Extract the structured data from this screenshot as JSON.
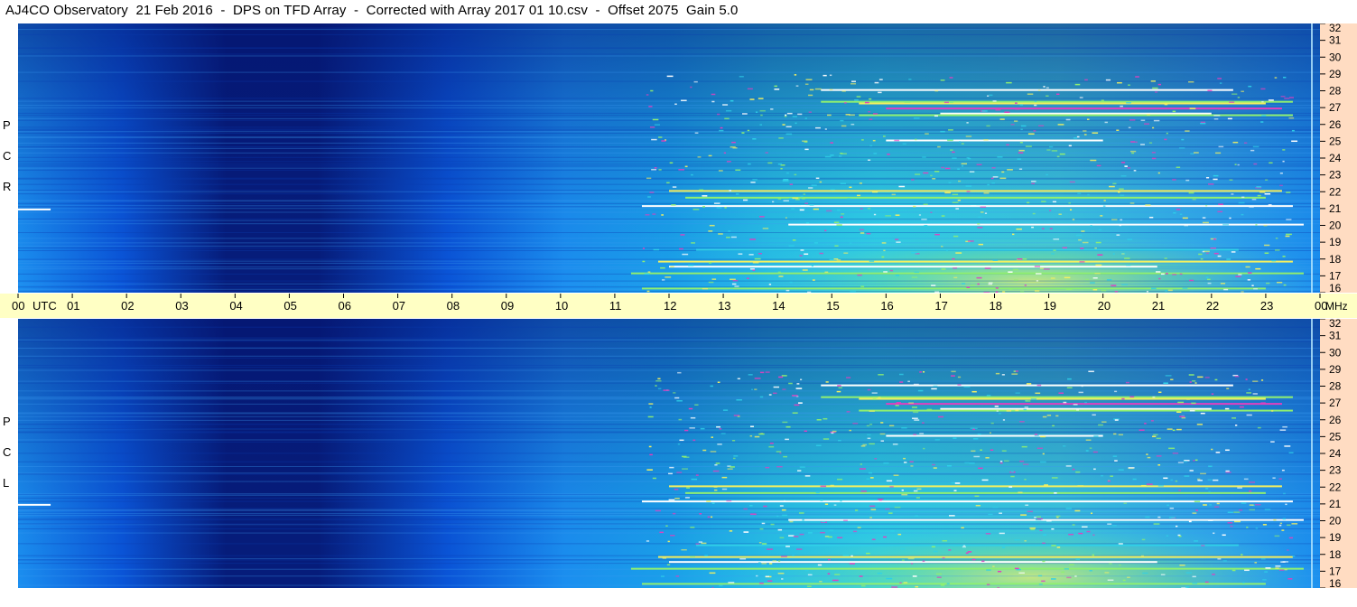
{
  "title": "AJ4CO Observatory  21 Feb 2016  -  DPS on TFD Array  -  Corrected with Array 2017 01 10.csv  -  Offset 2075  Gain 5.0",
  "chart_data": {
    "type": "heatmap",
    "panels": [
      {
        "name": "RCP",
        "label_letters": [
          "P",
          "C",
          "R"
        ]
      },
      {
        "name": "LCP",
        "label_letters": [
          "P",
          "C",
          "L"
        ]
      }
    ],
    "x_axis": {
      "unit_label": "UTC",
      "range_hours": [
        0,
        24
      ],
      "tick_labels": [
        "00",
        "01",
        "02",
        "03",
        "04",
        "05",
        "06",
        "07",
        "08",
        "09",
        "10",
        "11",
        "12",
        "13",
        "14",
        "15",
        "16",
        "17",
        "18",
        "19",
        "20",
        "21",
        "22",
        "23",
        "00"
      ]
    },
    "y_axis": {
      "unit_label": "MHz",
      "range_mhz": [
        16,
        32
      ],
      "tick_labels": [
        "32",
        "31",
        "30",
        "29",
        "28",
        "27",
        "26",
        "25",
        "24",
        "23",
        "22",
        "21",
        "20",
        "19",
        "18",
        "17",
        "16"
      ]
    },
    "colors": {
      "dark": "#061c7a",
      "mid": "#0a55d8",
      "light": "#1b8ff0",
      "cyan": "#2fd0e8",
      "green": "#90f070",
      "yellow": "#f4f060",
      "white": "#ffffff",
      "magenta": "#e040c0",
      "time_axis_bg": "#ffffc4",
      "freq_axis_bg": "#ffdcc2"
    }
  }
}
